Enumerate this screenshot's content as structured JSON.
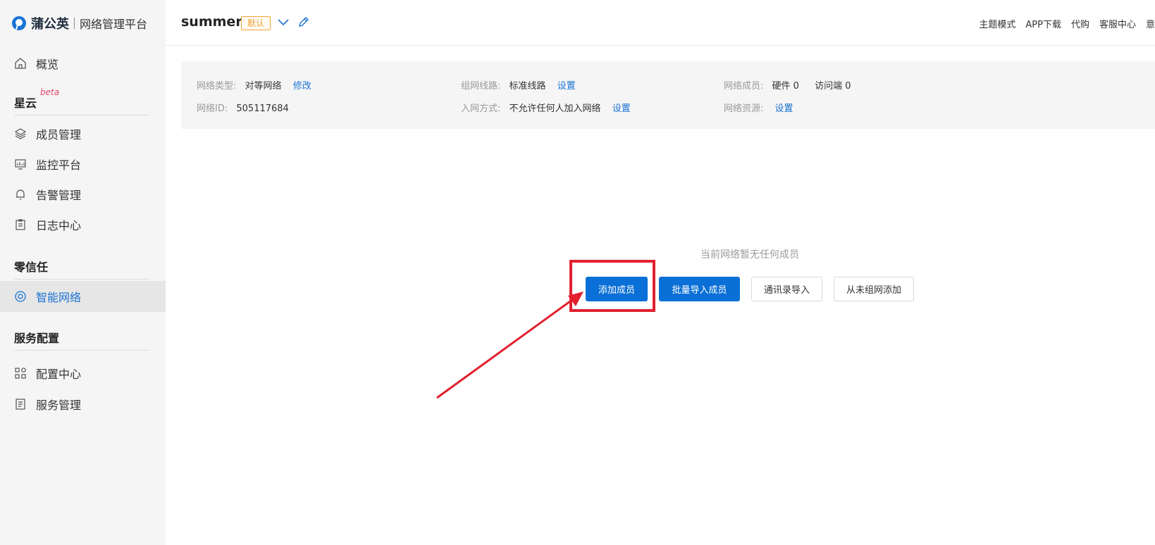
{
  "brand": {
    "name": "蒲公英",
    "subtitle": "网络管理平台"
  },
  "sidebar": {
    "overview": "概览",
    "sections": [
      {
        "title": "星云",
        "badge": "beta",
        "items": [
          "成员管理",
          "监控平台",
          "告警管理",
          "日志中心"
        ]
      },
      {
        "title": "零信任",
        "items": [
          "智能网络"
        ]
      },
      {
        "title": "服务配置",
        "items": [
          "配置中心",
          "服务管理"
        ]
      }
    ],
    "active_item": "智能网络"
  },
  "header": {
    "network_name": "summer",
    "default_badge": "默认",
    "links": [
      "主题模式",
      "APP下载",
      "代购",
      "客服中心",
      "意"
    ]
  },
  "info": {
    "network_type": {
      "label": "网络类型:",
      "value": "对等网络",
      "action": "修改"
    },
    "network_id": {
      "label": "网络ID:",
      "value": "505117684"
    },
    "route": {
      "label": "组网线路:",
      "value": "标准线路",
      "action": "设置"
    },
    "join_method": {
      "label": "入网方式:",
      "value": "不允许任何人加入网络",
      "action": "设置"
    },
    "members": {
      "label": "网络成员:",
      "hardware": "硬件 0",
      "visitor": "访问端 0"
    },
    "resources": {
      "label": "网络资源:",
      "action": "设置"
    }
  },
  "empty_state": {
    "message": "当前网络暂无任何成员",
    "buttons": [
      "添加成员",
      "批量导入成员",
      "通讯录导入",
      "从未组网添加"
    ]
  },
  "colors": {
    "accent": "#1a73d4",
    "primary_button": "#0a6fd6",
    "badge": "#f0a334",
    "annotation": "#e2202e"
  }
}
